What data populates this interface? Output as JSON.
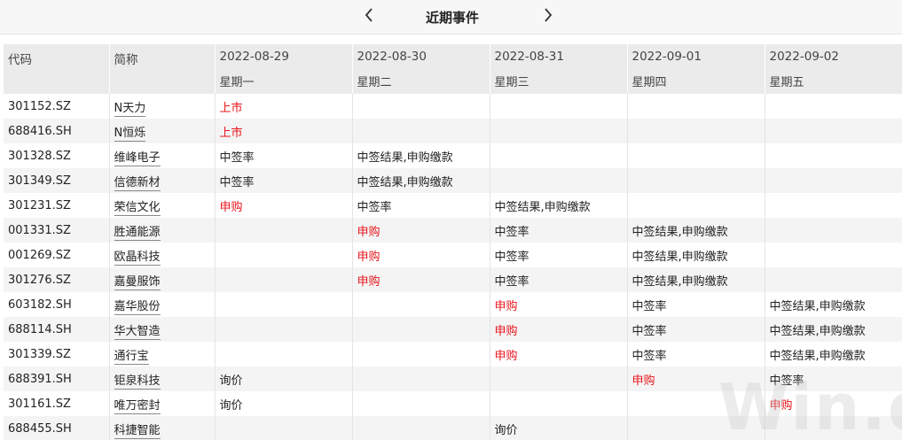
{
  "header": {
    "title": "近期事件"
  },
  "columns": {
    "code": "代码",
    "name": "简称",
    "days": [
      {
        "date": "2022-08-29",
        "weekday": "星期一"
      },
      {
        "date": "2022-08-30",
        "weekday": "星期二"
      },
      {
        "date": "2022-08-31",
        "weekday": "星期三"
      },
      {
        "date": "2022-09-01",
        "weekday": "星期四"
      },
      {
        "date": "2022-09-02",
        "weekday": "星期五"
      }
    ]
  },
  "colors": {
    "highlight": "#e8131a",
    "header_bg": "#ebebeb",
    "stripe": "#f4f4f4"
  },
  "rows": [
    {
      "code": "301152.SZ",
      "name": "N天力",
      "events": [
        {
          "text": "上市",
          "red": true
        },
        {
          "text": ""
        },
        {
          "text": ""
        },
        {
          "text": ""
        },
        {
          "text": ""
        }
      ]
    },
    {
      "code": "688416.SH",
      "name": "N恒烁",
      "events": [
        {
          "text": "上市",
          "red": true
        },
        {
          "text": ""
        },
        {
          "text": ""
        },
        {
          "text": ""
        },
        {
          "text": ""
        }
      ]
    },
    {
      "code": "301328.SZ",
      "name": "维峰电子",
      "events": [
        {
          "text": "中签率"
        },
        {
          "text": "中签结果,申购缴款"
        },
        {
          "text": ""
        },
        {
          "text": ""
        },
        {
          "text": ""
        }
      ]
    },
    {
      "code": "301349.SZ",
      "name": "信德新材",
      "events": [
        {
          "text": "中签率"
        },
        {
          "text": "中签结果,申购缴款"
        },
        {
          "text": ""
        },
        {
          "text": ""
        },
        {
          "text": ""
        }
      ]
    },
    {
      "code": "301231.SZ",
      "name": "荣信文化",
      "events": [
        {
          "text": "申购",
          "red": true
        },
        {
          "text": "中签率"
        },
        {
          "text": "中签结果,申购缴款"
        },
        {
          "text": ""
        },
        {
          "text": ""
        }
      ]
    },
    {
      "code": "001331.SZ",
      "name": "胜通能源",
      "events": [
        {
          "text": ""
        },
        {
          "text": "申购",
          "red": true
        },
        {
          "text": "中签率"
        },
        {
          "text": "中签结果,申购缴款"
        },
        {
          "text": ""
        }
      ]
    },
    {
      "code": "001269.SZ",
      "name": "欧晶科技",
      "events": [
        {
          "text": ""
        },
        {
          "text": "申购",
          "red": true
        },
        {
          "text": "中签率"
        },
        {
          "text": "中签结果,申购缴款"
        },
        {
          "text": ""
        }
      ]
    },
    {
      "code": "301276.SZ",
      "name": "嘉曼服饰",
      "events": [
        {
          "text": ""
        },
        {
          "text": "申购",
          "red": true
        },
        {
          "text": "中签率"
        },
        {
          "text": "中签结果,申购缴款"
        },
        {
          "text": ""
        }
      ]
    },
    {
      "code": "603182.SH",
      "name": "嘉华股份",
      "events": [
        {
          "text": ""
        },
        {
          "text": ""
        },
        {
          "text": "申购",
          "red": true
        },
        {
          "text": "中签率"
        },
        {
          "text": "中签结果,申购缴款"
        }
      ]
    },
    {
      "code": "688114.SH",
      "name": "华大智造",
      "events": [
        {
          "text": ""
        },
        {
          "text": ""
        },
        {
          "text": "申购",
          "red": true
        },
        {
          "text": "中签率"
        },
        {
          "text": "中签结果,申购缴款"
        }
      ]
    },
    {
      "code": "301339.SZ",
      "name": "通行宝",
      "events": [
        {
          "text": ""
        },
        {
          "text": ""
        },
        {
          "text": "申购",
          "red": true
        },
        {
          "text": "中签率"
        },
        {
          "text": "中签结果,申购缴款"
        }
      ]
    },
    {
      "code": "688391.SH",
      "name": "钜泉科技",
      "events": [
        {
          "text": "询价"
        },
        {
          "text": ""
        },
        {
          "text": ""
        },
        {
          "text": "申购",
          "red": true
        },
        {
          "text": "中签率"
        }
      ]
    },
    {
      "code": "301161.SZ",
      "name": "唯万密封",
      "events": [
        {
          "text": "询价"
        },
        {
          "text": ""
        },
        {
          "text": ""
        },
        {
          "text": ""
        },
        {
          "text": "申购",
          "red": true
        }
      ]
    },
    {
      "code": "688455.SH",
      "name": "科捷智能",
      "events": [
        {
          "text": ""
        },
        {
          "text": ""
        },
        {
          "text": "询价"
        },
        {
          "text": ""
        },
        {
          "text": ""
        }
      ]
    }
  ],
  "watermark": "Win.d"
}
